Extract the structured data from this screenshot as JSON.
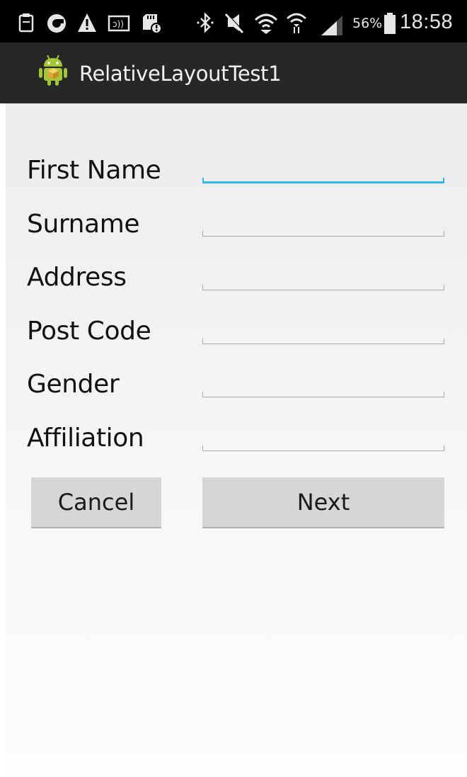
{
  "status_bar": {
    "battery_percent": "56%",
    "time": "18:58",
    "icons": [
      "clipboard-icon",
      "circle-app-icon",
      "warning-icon",
      "nfc-icon",
      "sd-card-alert-icon",
      "bluetooth-icon",
      "mute-icon",
      "wifi-icon",
      "wifi-data-icon",
      "signal-icon",
      "battery-icon"
    ]
  },
  "action_bar": {
    "title": "RelativeLayoutTest1",
    "icon": "android-icon"
  },
  "form": {
    "fields": [
      {
        "label": "First Name",
        "value": "",
        "focused": true
      },
      {
        "label": "Surname",
        "value": "",
        "focused": false
      },
      {
        "label": "Address",
        "value": "",
        "focused": false
      },
      {
        "label": "Post Code",
        "value": "",
        "focused": false
      },
      {
        "label": "Gender",
        "value": "",
        "focused": false
      },
      {
        "label": "Affiliation",
        "value": "",
        "focused": false
      }
    ],
    "cancel_label": "Cancel",
    "next_label": "Next"
  },
  "colors": {
    "focus_accent": "#33b5e5",
    "action_bar": "#272727",
    "button": "#d6d6d6"
  }
}
